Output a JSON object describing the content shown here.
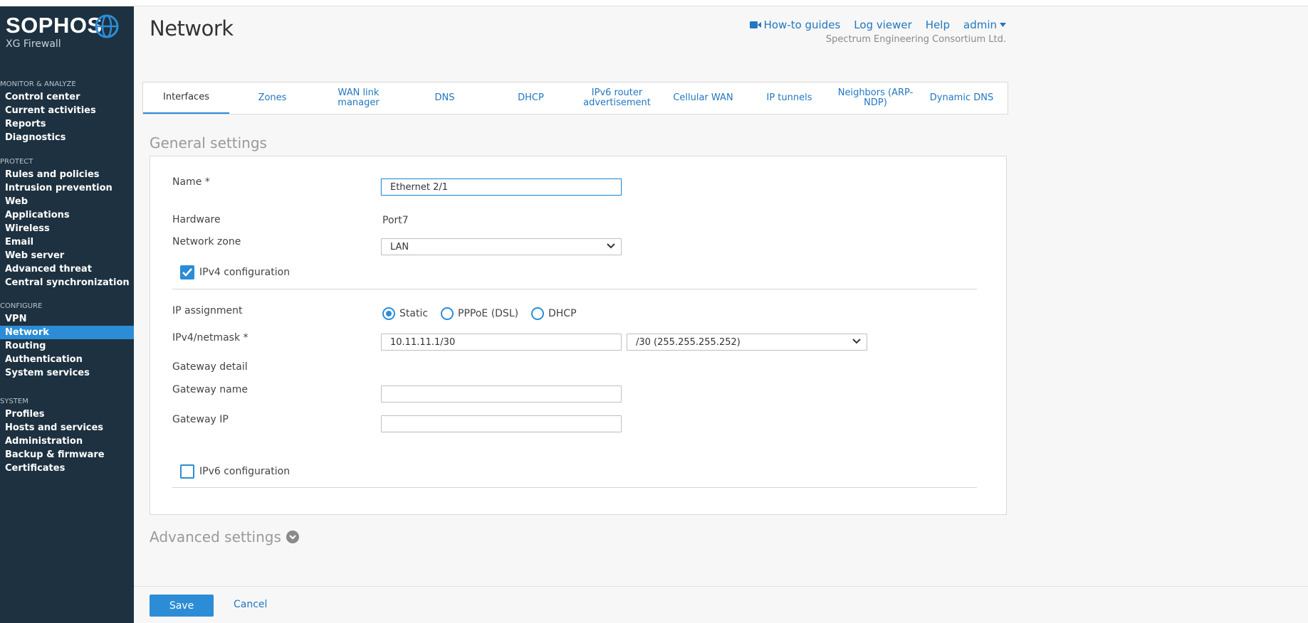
{
  "brand": {
    "name": "SOPHOS",
    "product": "XG Firewall"
  },
  "sidebar": {
    "sections": [
      {
        "heading": "MONITOR & ANALYZE",
        "items": [
          "Control center",
          "Current activities",
          "Reports",
          "Diagnostics"
        ]
      },
      {
        "heading": "PROTECT",
        "items": [
          "Rules and policies",
          "Intrusion prevention",
          "Web",
          "Applications",
          "Wireless",
          "Email",
          "Web server",
          "Advanced threat",
          "Central synchronization"
        ]
      },
      {
        "heading": "CONFIGURE",
        "items": [
          "VPN",
          "Network",
          "Routing",
          "Authentication",
          "System services"
        ]
      },
      {
        "heading": "SYSTEM",
        "items": [
          "Profiles",
          "Hosts and services",
          "Administration",
          "Backup & firmware",
          "Certificates"
        ]
      }
    ],
    "active_item": "Network"
  },
  "header": {
    "title": "Network",
    "links": {
      "howto": "How-to guides",
      "logviewer": "Log viewer",
      "help": "Help",
      "user": "admin"
    },
    "company": "Spectrum Engineering Consortium Ltd."
  },
  "tabs": [
    {
      "label": "Interfaces",
      "active": true
    },
    {
      "label": "Zones"
    },
    {
      "label": "WAN link manager"
    },
    {
      "label": "DNS"
    },
    {
      "label": "DHCP"
    },
    {
      "label": "IPv6 router advertisement"
    },
    {
      "label": "Cellular WAN"
    },
    {
      "label": "IP tunnels"
    },
    {
      "label": "Neighbors (ARP-NDP)"
    },
    {
      "label": "Dynamic DNS"
    }
  ],
  "general": {
    "title": "General settings",
    "name_label": "Name *",
    "name_value": "Ethernet 2/1",
    "hardware_label": "Hardware",
    "hardware_value": "Port7",
    "zone_label": "Network zone",
    "zone_value": "LAN",
    "ipv4_config_label": "IPv4 configuration",
    "ipv4_config_checked": true,
    "ip_assignment_label": "IP assignment",
    "ip_assignment_options": [
      "Static",
      "PPPoE (DSL)",
      "DHCP"
    ],
    "ip_assignment_selected": "Static",
    "ipv4_label": "IPv4/netmask *",
    "ipv4_value": "10.11.11.1/30",
    "netmask_value": "/30 (255.255.255.252)",
    "gateway_detail_label": "Gateway detail",
    "gateway_name_label": "Gateway name",
    "gateway_name_value": "",
    "gateway_ip_label": "Gateway IP",
    "gateway_ip_value": "",
    "ipv6_config_label": "IPv6 configuration",
    "ipv6_config_checked": false
  },
  "advanced": {
    "title": "Advanced settings"
  },
  "footer": {
    "save": "Save",
    "cancel": "Cancel"
  },
  "colors": {
    "accent": "#2c8dd6",
    "link": "#2277c0",
    "sidebar": "#1d3140"
  }
}
